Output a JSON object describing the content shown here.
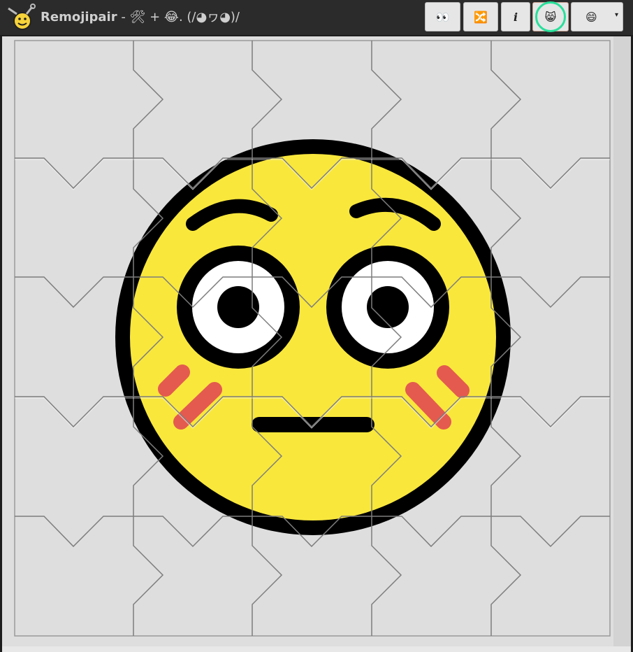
{
  "header": {
    "app_name": "Remojipair",
    "subtitle": " - 🛠 + 😂. (/◕ヮ◕)/"
  },
  "toolbar": {
    "buttons": [
      {
        "name": "eyes",
        "glyph": "👀"
      },
      {
        "name": "shuffle",
        "glyph": "🔀"
      },
      {
        "name": "info",
        "glyph": "i"
      },
      {
        "name": "cat",
        "glyph": "😸"
      },
      {
        "name": "emoji-select",
        "glyph": "😄"
      }
    ],
    "select_caret": "▾"
  },
  "puzzle": {
    "emoji": "flushed-face",
    "grid_rows": 5,
    "grid_cols": 5,
    "colors": {
      "board": "#dedede",
      "face": "#f9e73c",
      "outline": "#000000",
      "blush": "#e45a4f",
      "eye_white": "#ffffff"
    }
  }
}
